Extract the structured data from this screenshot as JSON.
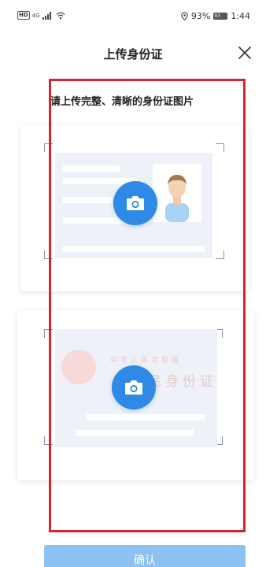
{
  "status_bar": {
    "hd": "HD",
    "network": "4G",
    "battery_percent": "93%",
    "battery_level": "93",
    "time": "1:44",
    "icons": [
      "signal-icon",
      "wifi-icon",
      "location-icon",
      "battery-icon"
    ]
  },
  "header": {
    "title": "上传身份证",
    "close_icon": "close-icon"
  },
  "instruction": "请上传完整、清晰的身份证图片",
  "front_card": {
    "camera_icon": "camera-icon",
    "illustration": "id-card-front-illustration"
  },
  "back_card": {
    "camera_icon": "camera-icon",
    "illustration": "id-card-back-illustration",
    "faint_line1": "中华人民共和国",
    "faint_line2": "居民身份证"
  },
  "confirm_button": "确认",
  "colors": {
    "accent": "#2e8ae6",
    "confirm_disabled": "#8cc2f2",
    "highlight": "#d9242f",
    "card_preview": "#eef1f7"
  }
}
